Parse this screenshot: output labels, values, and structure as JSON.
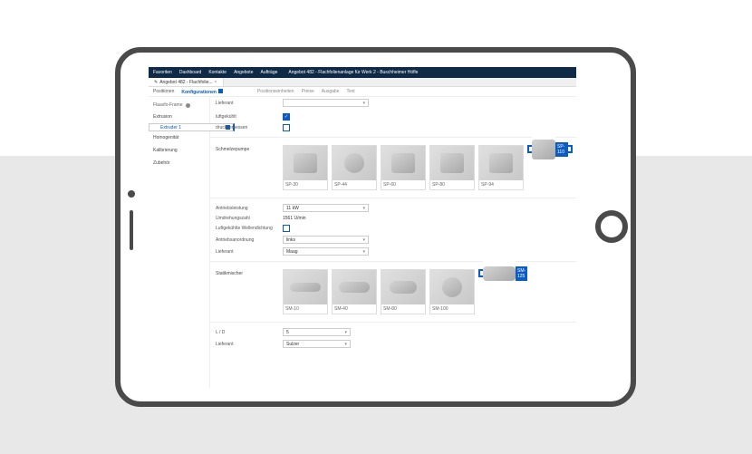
{
  "nav": {
    "items": [
      "Favoriten",
      "Dashboard",
      "Kontakte",
      "Angebote",
      "Aufträge"
    ],
    "crumb": "Angebot 482 - Flachfolienanlage für Werk 2 - Buschheimer Höfle"
  },
  "tabs": [
    {
      "label": "Angebot 482 - Flachfolie..."
    }
  ],
  "subheader": {
    "items": [
      "Positionen",
      "Konfigurationen"
    ],
    "extra": [
      "Positionseinheiten",
      "Preise",
      "Ausgabe",
      "Text"
    ]
  },
  "sidebar": {
    "header": "Flaaxfo-Frame",
    "items": [
      "Extrusion",
      "Extruder 1",
      "Homogenität",
      "Kalibrierung",
      "Zubehör"
    ],
    "selectedIndex": 1
  },
  "section1": {
    "group": "",
    "rows": [
      {
        "label": "Lieferant",
        "type": "select",
        "value": ""
      },
      {
        "label": "luftgekühlt",
        "type": "check",
        "checked": true
      },
      {
        "label": "druckgemessen",
        "type": "check",
        "checked": false
      }
    ]
  },
  "pumps": {
    "group": "Schmelzepumpe",
    "items": [
      {
        "label": "SP-30"
      },
      {
        "label": "SP-44"
      },
      {
        "label": "SP-60"
      },
      {
        "label": "SP-80"
      },
      {
        "label": "SP-94"
      },
      {
        "label": "SP-110",
        "selected": true
      }
    ]
  },
  "section2": {
    "rows": [
      {
        "label": "Antriebsleistung",
        "type": "select",
        "value": "11 kW"
      },
      {
        "label": "Umdrehungszahl",
        "type": "text",
        "value": "1561 U/min"
      },
      {
        "label": "Luftgekühlte Wellendichtung",
        "type": "check",
        "checked": false
      },
      {
        "label": "Antriebsanordnung",
        "type": "select",
        "value": "links"
      },
      {
        "label": "Lieferant",
        "type": "select",
        "value": "Maag"
      }
    ]
  },
  "mixers": {
    "group": "Statikmischer",
    "items": [
      {
        "label": "SM-10"
      },
      {
        "label": "SM-40"
      },
      {
        "label": "SM-80"
      },
      {
        "label": "SM-100"
      },
      {
        "label": "SM-125",
        "selected": true
      }
    ]
  },
  "section3": {
    "rows": [
      {
        "label": "L / D",
        "type": "select",
        "value": "5"
      },
      {
        "label": "Lieferant",
        "type": "select",
        "value": "Sulzer"
      }
    ]
  }
}
